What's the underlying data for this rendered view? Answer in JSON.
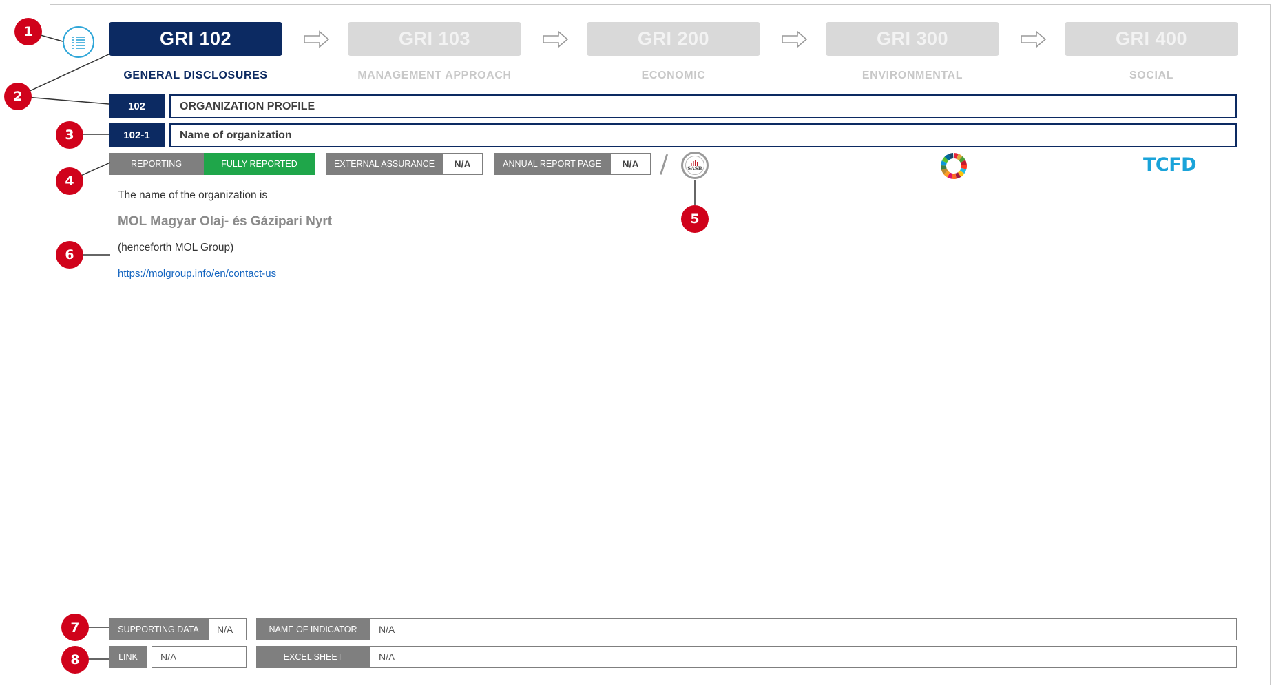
{
  "callouts": [
    "1",
    "2",
    "3",
    "4",
    "5",
    "6",
    "7",
    "8"
  ],
  "steps": [
    {
      "code": "GRI 102",
      "label": "GENERAL DISCLOSURES"
    },
    {
      "code": "GRI 103",
      "label": "MANAGEMENT APPROACH"
    },
    {
      "code": "GRI 200",
      "label": "ECONOMIC"
    },
    {
      "code": "GRI 300",
      "label": "ENVIRONMENTAL"
    },
    {
      "code": "GRI 400",
      "label": "SOCIAL"
    }
  ],
  "section": {
    "code": "102",
    "title": "ORGANIZATION PROFILE"
  },
  "indicator": {
    "code": "102-1",
    "title": "Name of organization"
  },
  "status": {
    "reporting_label": "REPORTING",
    "reporting_value": "FULLY REPORTED",
    "assurance_label": "EXTERNAL ASSURANCE",
    "assurance_value": "N/A",
    "page_label": "ANNUAL REPORT PAGE",
    "page_value": "N/A",
    "slash": "/"
  },
  "frameworks": {
    "sasb": "SASB",
    "tcfd": "TCFD"
  },
  "content": {
    "intro": "The name of the organization is",
    "org_name": "MOL Magyar Olaj- és Gázipari Nyrt",
    "note": "(henceforth MOL Group)",
    "link": "https://molgroup.info/en/contact-us"
  },
  "footer": {
    "supporting_label": "SUPPORTING DATA",
    "supporting_value": "N/A",
    "indicator_name_label": "NAME OF INDICATOR",
    "indicator_name_value": "N/A",
    "link_label": "LINK",
    "link_value": "N/A",
    "excel_label": "EXCEL SHEET",
    "excel_value": "N/A"
  },
  "colors": {
    "navy": "#0c2a62",
    "green": "#1fa64a",
    "gray": "#7f7f7f",
    "callout": "#d0021b",
    "tcfd": "#1aa3d9"
  },
  "icons": {
    "menu": "list-menu-icon",
    "arrow": "right-arrow-icon",
    "sasb": "sasb-logo",
    "sdg": "sdg-wheel-icon"
  }
}
